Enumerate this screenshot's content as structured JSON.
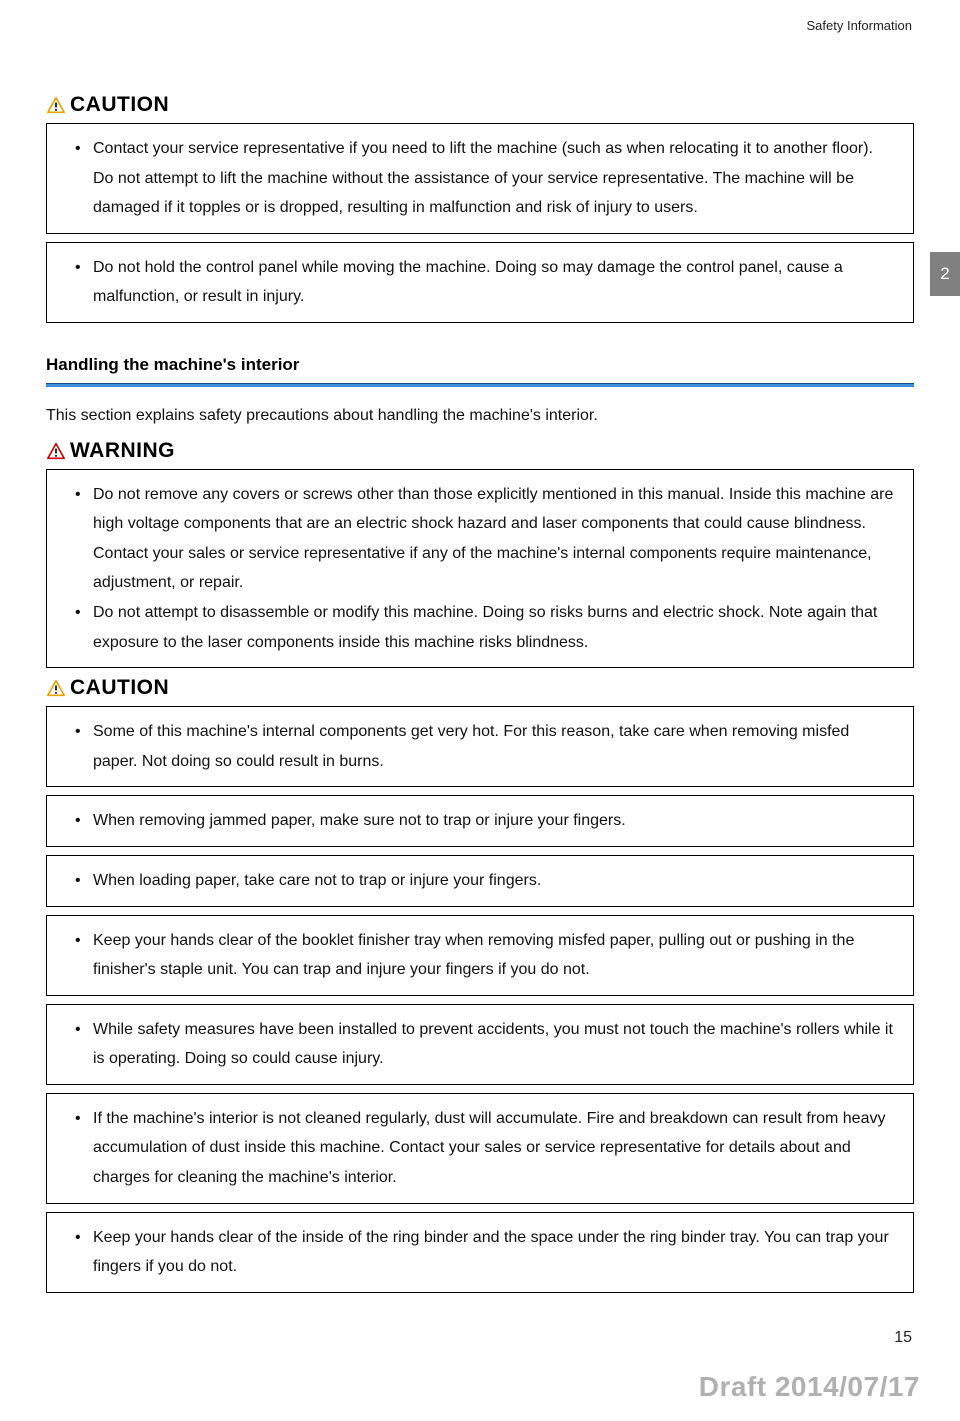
{
  "header": {
    "section_label": "Safety Information"
  },
  "side_tab": "2",
  "caution1": {
    "label": "CAUTION",
    "items": [
      "Contact your service representative if you need to lift the machine (such as when relocating it to another floor). Do not attempt to lift the machine without the assistance of your service representative. The machine will be damaged if it topples or is dropped, resulting in malfunction and risk of injury to users."
    ]
  },
  "caution1b": {
    "items": [
      "Do not hold the control panel while moving the machine. Doing so may damage the control panel, cause a malfunction, or result in injury."
    ]
  },
  "section": {
    "heading": "Handling the machine's interior",
    "intro": "This section explains safety precautions about handling the machine's interior."
  },
  "warning": {
    "label": "WARNING",
    "items": [
      "Do not remove any covers or screws other than those explicitly mentioned in this manual. Inside this machine are high voltage components that are an electric shock hazard and laser components that could cause blindness. Contact your sales or service representative if any of the machine's internal components require maintenance, adjustment, or repair.",
      "Do not attempt to disassemble or modify this machine. Doing so risks burns and electric shock. Note again that exposure to the laser components inside this machine risks blindness."
    ]
  },
  "caution2": {
    "label": "CAUTION",
    "box1": [
      "Some of this machine's internal components get very hot. For this reason, take care when removing misfed paper. Not doing so could result in burns."
    ],
    "box2": [
      "When removing jammed paper, make sure not to trap or injure your fingers."
    ],
    "box3": [
      "When loading paper, take care not to trap or injure your fingers."
    ],
    "box4": [
      "Keep your hands clear of the booklet finisher tray when removing misfed paper, pulling out or pushing in the finisher's staple unit. You can trap and injure your fingers if you do not."
    ],
    "box5": [
      "While safety measures have been installed to prevent accidents, you must not touch the machine's rollers while it is operating. Doing so could cause injury."
    ],
    "box6": [
      "If the machine's interior is not cleaned regularly, dust will accumulate. Fire and breakdown can result from heavy accumulation of dust inside this machine. Contact your sales or service representative for details about and charges for cleaning the machine's interior."
    ],
    "box7": [
      "Keep your hands clear of the inside of the ring binder and the space under the ring binder tray. You can trap your fingers if you do not."
    ]
  },
  "page_number": "15",
  "draft_stamp": "Draft 2014/07/17"
}
